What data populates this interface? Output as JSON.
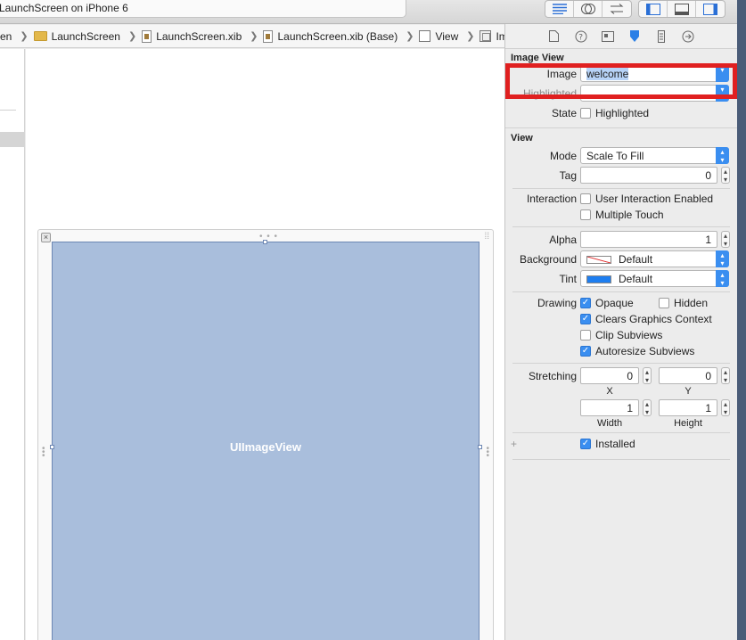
{
  "activity": {
    "title": "LaunchScreen on iPhone 6"
  },
  "toolbar": {
    "editor_group_icons": [
      "align-left-icon",
      "venn-icon",
      "swap-arrows-icon"
    ],
    "panel_icons": [
      "left-panel-icon",
      "bottom-panel-icon",
      "right-panel-icon"
    ]
  },
  "jumpbar": {
    "crumbs": [
      "en",
      "LaunchScreen",
      "LaunchScreen.xib",
      "LaunchScreen.xib (Base)",
      "View",
      "Image View"
    ]
  },
  "canvas": {
    "imageview_label": "UIImageView"
  },
  "inspector": {
    "tabs": [
      "file-icon",
      "help-icon",
      "identity-icon",
      "attributes-icon",
      "size-icon",
      "connections-icon"
    ],
    "image_view": {
      "title": "Image View",
      "image_label": "Image",
      "image_value": "welcome",
      "highlighted_label": "Highlighted",
      "state_label": "State",
      "state_option": "Highlighted"
    },
    "view": {
      "title": "View",
      "mode_label": "Mode",
      "mode_value": "Scale To Fill",
      "tag_label": "Tag",
      "tag_value": "0",
      "interaction_label": "Interaction",
      "user_interaction": "User Interaction Enabled",
      "multiple_touch": "Multiple Touch",
      "alpha_label": "Alpha",
      "alpha_value": "1",
      "background_label": "Background",
      "background_value": "Default",
      "tint_label": "Tint",
      "tint_value": "Default",
      "drawing_label": "Drawing",
      "opaque": "Opaque",
      "hidden": "Hidden",
      "clears_graphics": "Clears Graphics Context",
      "clip_subviews": "Clip Subviews",
      "autoresize_subviews": "Autoresize Subviews",
      "stretching_label": "Stretching",
      "stretch_x": "0",
      "stretch_y": "0",
      "stretch_width": "1",
      "stretch_height": "1",
      "x_label": "X",
      "y_label": "Y",
      "width_label": "Width",
      "height_label": "Height",
      "installed": "Installed",
      "plus": "+"
    }
  },
  "colors": {
    "accent": "#3a8ef0",
    "imageview_fill": "#a9bedc",
    "highlight": "#e02020",
    "tint": "#1e7ef0"
  }
}
